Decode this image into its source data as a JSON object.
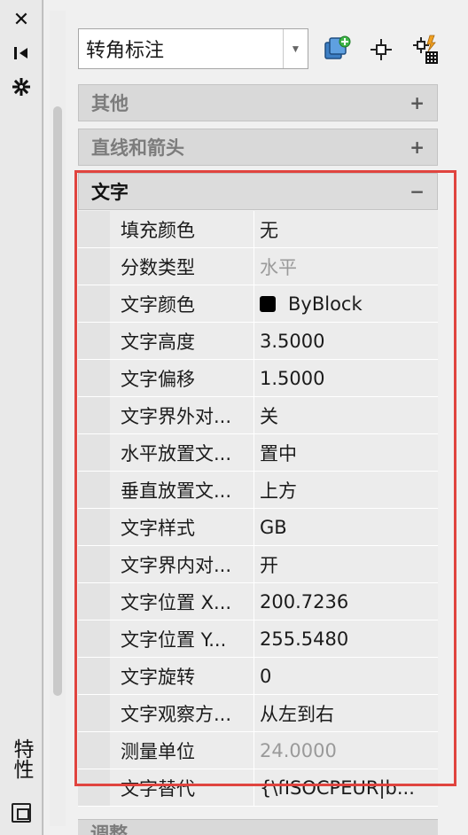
{
  "strip": {
    "title": "特性"
  },
  "dropdown": {
    "value": "转角标注"
  },
  "categories": {
    "other": {
      "label": "其他",
      "toggle": "+"
    },
    "lines": {
      "label": "直线和箭头",
      "toggle": "+"
    },
    "text": {
      "label": "文字",
      "toggle": "−"
    },
    "next": {
      "label": "调整"
    }
  },
  "properties": [
    {
      "name": "填充颜色",
      "value": "无"
    },
    {
      "name": "分数类型",
      "value": "水平"
    },
    {
      "name": "文字颜色",
      "value": "ByBlock"
    },
    {
      "name": "文字高度",
      "value": "3.5000"
    },
    {
      "name": "文字偏移",
      "value": "1.5000"
    },
    {
      "name": "文字界外对...",
      "value": "关"
    },
    {
      "name": "水平放置文...",
      "value": "置中"
    },
    {
      "name": "垂直放置文...",
      "value": "上方"
    },
    {
      "name": "文字样式",
      "value": "GB"
    },
    {
      "name": "文字界内对...",
      "value": "开"
    },
    {
      "name": "文字位置 X...",
      "value": "200.7236"
    },
    {
      "name": "文字位置 Y...",
      "value": "255.5480"
    },
    {
      "name": "文字旋转",
      "value": "0"
    },
    {
      "name": "文字观察方...",
      "value": "从左到右"
    },
    {
      "name": "测量单位",
      "value": "24.0000"
    },
    {
      "name": "文字替代",
      "value": "{\\fISOCPEUR|b..."
    }
  ],
  "colors": {
    "highlight": "#e0443f",
    "swatch": "#000000"
  },
  "icons": {
    "close": "close-icon",
    "pin": "auto-hide-icon",
    "settings": "settings-icon",
    "quick_select": "quick-select-icon",
    "select_objects": "select-objects-icon",
    "pickadd": "toggle-pickadd-icon"
  }
}
